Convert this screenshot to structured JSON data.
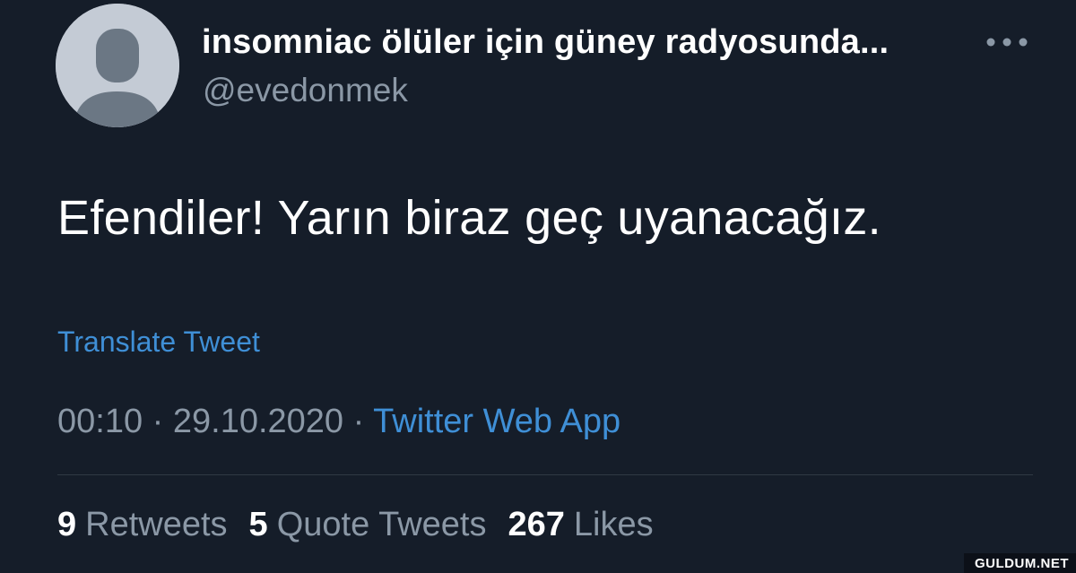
{
  "tweet": {
    "display_name": "insomniac ölüler için güney radyosunda...",
    "handle": "@evedonmek",
    "text": "Efendiler! Yarın biraz geç uyanacağız.",
    "translate_label": "Translate Tweet",
    "time": "00:10",
    "separator": "·",
    "date": "29.10.2020",
    "source": "Twitter Web App",
    "stats": {
      "retweets_count": "9",
      "retweets_label": "Retweets",
      "quotes_count": "5",
      "quotes_label": "Quote Tweets",
      "likes_count": "267",
      "likes_label": "Likes"
    }
  },
  "icons": {
    "avatar": "default-profile-icon",
    "more": "more-options-icon"
  },
  "colors": {
    "background": "#151d29",
    "primary_text": "#ffffff",
    "secondary_text": "#8b98a6",
    "link": "#3f8fd6",
    "divider": "#2f3944",
    "avatar_bg": "#c4cbd5",
    "avatar_silhouette": "#6b7784"
  },
  "watermark": "GULDUM.NET"
}
